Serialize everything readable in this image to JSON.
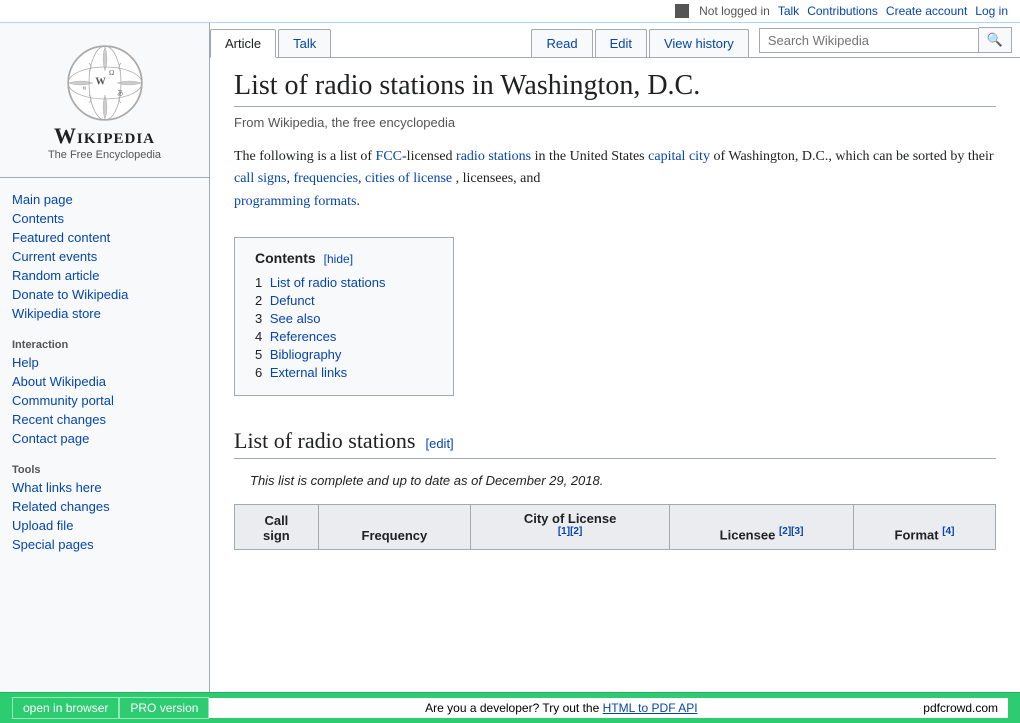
{
  "topbar": {
    "not_logged_in": "Not logged in",
    "talk": "Talk",
    "contributions": "Contributions",
    "create_account": "Create account",
    "log_in": "Log in"
  },
  "logo": {
    "title": "Wikipedia",
    "subtitle": "The Free Encyclopedia"
  },
  "sidebar": {
    "navigation": [
      {
        "label": "Main page",
        "href": "#"
      },
      {
        "label": "Contents",
        "href": "#"
      },
      {
        "label": "Featured content",
        "href": "#"
      },
      {
        "label": "Current events",
        "href": "#"
      },
      {
        "label": "Random article",
        "href": "#"
      },
      {
        "label": "Donate to Wikipedia",
        "href": "#"
      },
      {
        "label": "Wikipedia store",
        "href": "#"
      }
    ],
    "interaction_title": "Interaction",
    "interaction": [
      {
        "label": "Help",
        "href": "#"
      },
      {
        "label": "About Wikipedia",
        "href": "#"
      },
      {
        "label": "Community portal",
        "href": "#"
      },
      {
        "label": "Recent changes",
        "href": "#"
      },
      {
        "label": "Contact page",
        "href": "#"
      }
    ],
    "tools_title": "Tools",
    "tools": [
      {
        "label": "What links here",
        "href": "#"
      },
      {
        "label": "Related changes",
        "href": "#"
      },
      {
        "label": "Upload file",
        "href": "#"
      },
      {
        "label": "Special pages",
        "href": "#"
      }
    ]
  },
  "tabs": {
    "article": "Article",
    "talk": "Talk",
    "read": "Read",
    "edit": "Edit",
    "view_history": "View history"
  },
  "search": {
    "placeholder": "Search Wikipedia",
    "button": "🔍"
  },
  "article": {
    "title": "List of radio stations in Washington, D.C.",
    "from_line": "From Wikipedia, the free encyclopedia",
    "intro": "The following is a list of",
    "fcc": "FCC",
    "licensed": "-licensed",
    "radio_stations": "radio stations",
    "in_the_us": "in the United States",
    "capital_city": "capital city",
    "of_dc": "of Washington, D.C., which can be sorted by their",
    "call_signs": "call signs",
    "frequencies": "frequencies",
    "cities_of_license": "cities of license",
    "licensees_and": ", licensees, and",
    "programming_formats": "programming formats",
    "period": ".",
    "toc_title": "Contents",
    "toc_hide": "[hide]",
    "toc_items": [
      {
        "num": "1",
        "label": "List of radio stations"
      },
      {
        "num": "2",
        "label": "Defunct"
      },
      {
        "num": "3",
        "label": "See also"
      },
      {
        "num": "4",
        "label": "References"
      },
      {
        "num": "5",
        "label": "Bibliography"
      },
      {
        "num": "6",
        "label": "External links"
      }
    ],
    "section1_title": "List of radio stations",
    "section1_edit": "[edit]",
    "section1_note": "This list is complete and up to date as of December 29, 2018.",
    "table_headers": {
      "call_sign": "Call sign",
      "frequency": "Frequency",
      "city_of_license": "City of License",
      "city_refs": "[1][2]",
      "licensee": "Licensee",
      "licensee_refs": "[2][3]",
      "format": "Format",
      "format_refs": "[4]"
    }
  },
  "bottombar": {
    "open_in_browser": "open in browser",
    "pro_version": "PRO version",
    "message": "Are you a developer? Try out the",
    "html_to_pdf": "HTML to PDF API",
    "pdfcrowd": "pdfcrowd.com"
  }
}
